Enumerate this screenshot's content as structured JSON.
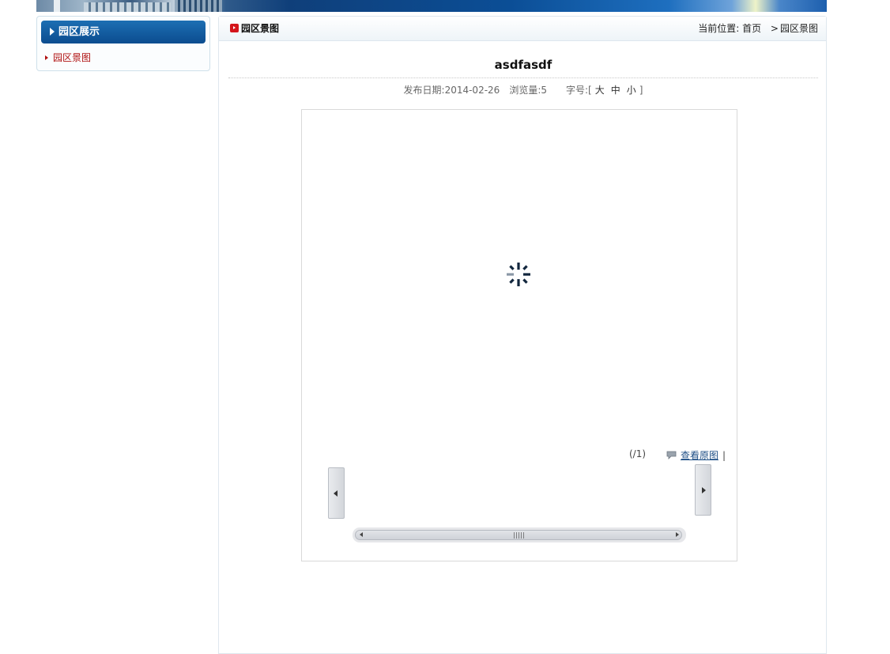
{
  "sidebar": {
    "header": "园区展示",
    "items": [
      {
        "label": "园区景图"
      }
    ]
  },
  "main": {
    "title": "园区景图",
    "breadcrumb": {
      "prefix": "当前位置:",
      "home": "首页",
      "separator": ">",
      "current": "园区景图"
    }
  },
  "article": {
    "title": "asdfasdf",
    "meta": {
      "date_label": "发布日期:",
      "date": "2014-02-26",
      "views_label": "浏览量:",
      "views": "5",
      "fontsize_label": "字号:",
      "bracket_open": "[",
      "size_large": "大",
      "size_medium": "中",
      "size_small": "小",
      "bracket_close": "]"
    }
  },
  "gallery": {
    "counter": "(/1)",
    "view_original": "查看原图",
    "divider": "|",
    "icons": {
      "spinner": "loading-spinner-icon",
      "comment": "comment-icon",
      "prev": "arrow-left-icon",
      "next": "arrow-right-icon"
    }
  },
  "colors": {
    "accent_red": "#b01212",
    "header_blue": "#0b4c8f",
    "link_blue": "#1f4f86"
  }
}
